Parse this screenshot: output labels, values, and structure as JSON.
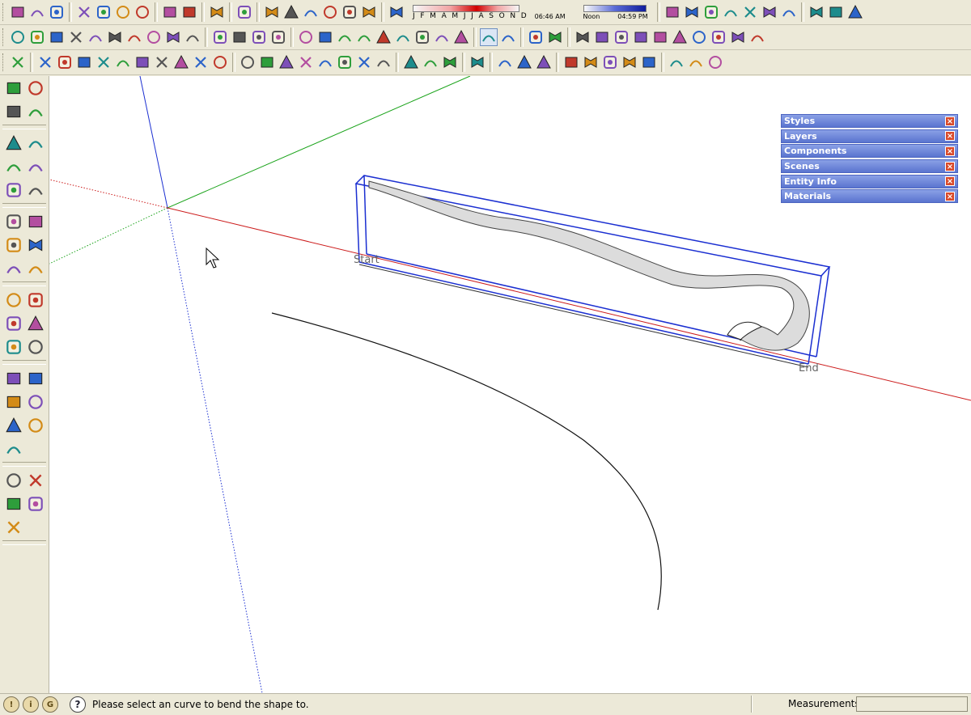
{
  "shadow": {
    "months": "J F M A M J J A S O N D",
    "time_left": "06:46 AM",
    "time_mid": "Noon",
    "time_right": "04:59 PM"
  },
  "toolbars": {
    "row1": [
      "new-icon",
      "open-icon",
      "save-icon",
      "cut-icon",
      "copy-icon",
      "paste-icon",
      "erase-icon",
      "undo-icon",
      "redo-icon",
      "print-icon",
      "model-info-icon",
      "iso-view-icon",
      "front-view-icon",
      "top-view-icon",
      "right-view-icon",
      "back-view-icon",
      "left-view-icon",
      "shadow-settings-icon",
      "display-shadows-icon",
      "xray-icon",
      "wireframe-icon",
      "hidden-line-icon",
      "shaded-icon",
      "shaded-texture-icon",
      "monochrome-icon",
      "photo-match-icon",
      "sandbox-icon",
      "component-icon"
    ],
    "row2": [
      "bezier-icon",
      "polyline-icon",
      "curve-icon",
      "spline-icon",
      "arc-icon",
      "spiral-icon",
      "arch-icon",
      "zigzag-icon",
      "ellipse-arc-icon",
      "freehand-icon",
      "polygon-icon",
      "wrench-icon",
      "oval-icon",
      "teardrop-icon",
      "line-icon",
      "square-icon",
      "circle-icon",
      "triangle-icon",
      "ellipse-icon",
      "parallelogram-icon",
      "quarter-arc-icon",
      "segment-circle-icon",
      "pie-icon",
      "offset-square-icon",
      "blob-icon",
      "quad-icon",
      "diamond-icon",
      "filter-select-icon",
      "filter-edge-icon",
      "filter-face-icon",
      "filter-group-icon",
      "filter-component-icon",
      "filter-layer-icon",
      "filter-hidden-icon",
      "filter-text-icon",
      "filter-guide-icon",
      "filter-axis-icon"
    ],
    "row3": [
      "add-point-icon",
      "guide-line-icon",
      "dimension-icon",
      "extrude-icon",
      "chair-icon",
      "paint-face-icon",
      "bucket-icon",
      "box-icon",
      "box-cut-icon",
      "box-copy-icon",
      "ribbon-icon",
      "soften-icon",
      "map-icon",
      "push-pull-group-icon",
      "scale-group-icon",
      "stretch-icon",
      "taper-icon",
      "twist-icon",
      "bend-icon",
      "cube-icon",
      "rotate-cycle-icon",
      "shape-bender-icon",
      "lift-icon",
      "section-icon",
      "sphere-icon",
      "star-icon",
      "axis-j-icon",
      "axis-v-icon",
      "axis-n-icon",
      "rotate-red-icon",
      "move-axis-icon",
      "pan-hand-icon",
      "layers-folder-icon",
      "window-icon"
    ]
  },
  "left_toolbar": [
    [
      "select-icon",
      "make-component-icon"
    ],
    [
      "paint-bucket-icon",
      "eraser-icon"
    ],
    [
      "rectangle-icon",
      "pencil-icon"
    ],
    [
      "circle-icon",
      "arc-icon"
    ],
    [
      "polygon-icon",
      "freehand-icon"
    ],
    [
      "move-icon",
      "push-pull-icon"
    ],
    [
      "rotate-icon",
      "follow-me-icon"
    ],
    [
      "scale-icon",
      "offset-icon"
    ],
    [
      "tape-measure-icon",
      "dimension-icon"
    ],
    [
      "protractor-icon",
      "text-label-icon"
    ],
    [
      "axes-icon",
      "3d-text-icon"
    ],
    [
      "orbit-icon",
      "pan-icon"
    ],
    [
      "zoom-icon",
      "zoom-window-icon"
    ],
    [
      "zoom-extents-icon",
      "previous-view-icon"
    ],
    [
      "zoom-all-icon",
      ""
    ],
    [
      "add-location-icon",
      "remove-location-icon"
    ],
    [
      "toggle-terrain-icon",
      "get-model-icon"
    ],
    [
      "share-model-icon",
      ""
    ]
  ],
  "tray": [
    {
      "title": "Styles"
    },
    {
      "title": "Layers"
    },
    {
      "title": "Components"
    },
    {
      "title": "Scenes"
    },
    {
      "title": "Entity Info"
    },
    {
      "title": "Materials"
    }
  ],
  "tray_close_glyph": "×",
  "viewport": {
    "start_label": "Start",
    "end_label": "End"
  },
  "status": {
    "message": "Please select an curve to bend the shape to.",
    "measurements_label": "Measurements",
    "measurements_value": ""
  }
}
